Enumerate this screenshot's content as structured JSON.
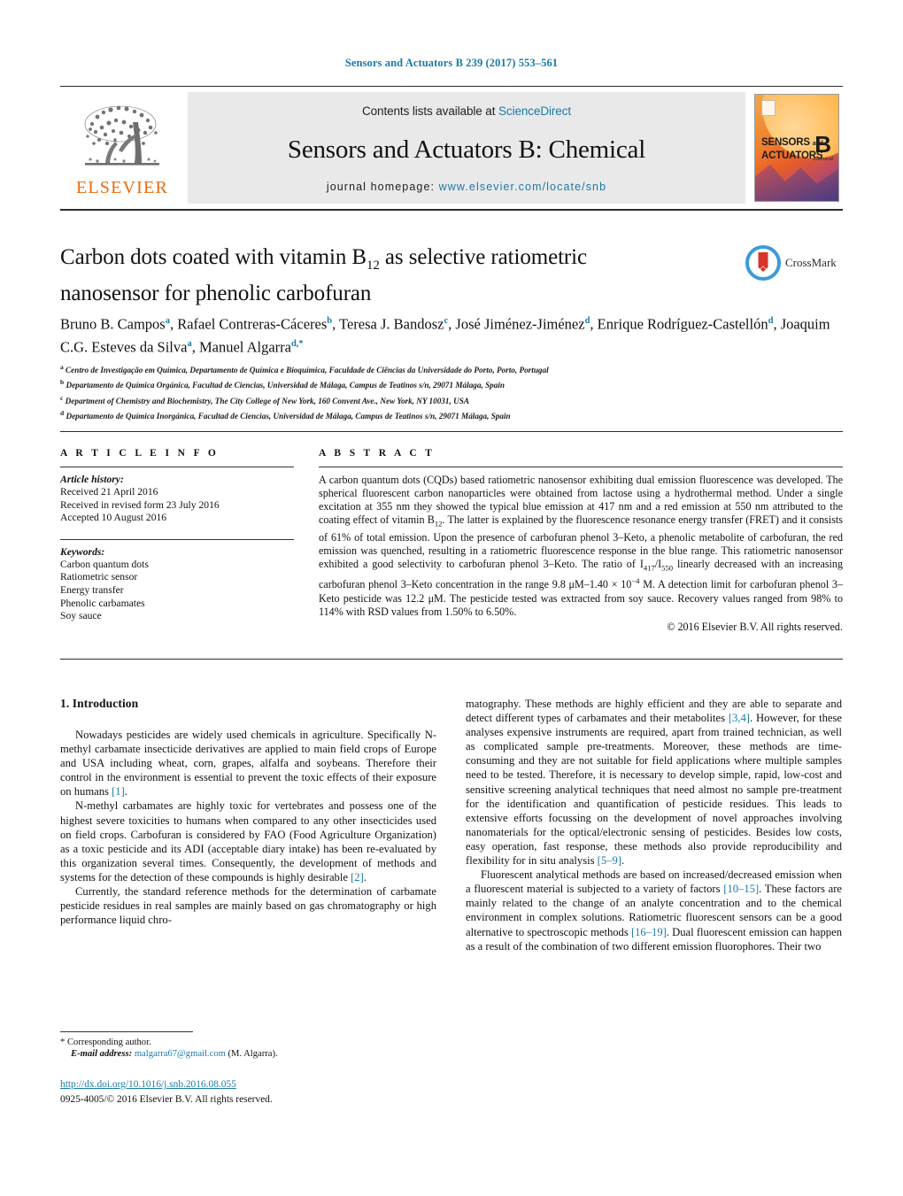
{
  "running_head": "Sensors and Actuators B 239 (2017) 553–561",
  "masthead": {
    "publisher_name": "ELSEVIER",
    "contents_prefix": "Contents lists available at ",
    "contents_link": "ScienceDirect",
    "journal_title": "Sensors and Actuators B: Chemical",
    "homepage_prefix": "journal homepage: ",
    "homepage_url": "www.elsevier.com/locate/snb",
    "cover_line1": "SENSORS",
    "cover_and": "and",
    "cover_line2": "ACTUATORS",
    "cover_volume": "B",
    "cover_sub": "Chemical"
  },
  "article": {
    "title_line1_a": "Carbon dots coated with vitamin B",
    "title_sub": "12",
    "title_line1_b": " as selective ratiometric",
    "title_line2": "nanosensor for phenolic carbofuran",
    "crossmark_label": "CrossMark",
    "authors_html": "Bruno B. Campos<sup>a</sup>, Rafael Contreras-Cáceres<sup>b</sup>, Teresa J. Bandosz<sup>c</sup>, José Jiménez-Jiménez<sup>d</sup>, Enrique Rodríguez-Castellón<sup>d</sup>, Joaquim C.G. Esteves da Silva<sup>a</sup>, Manuel Algarra<sup>d,*</sup>",
    "affiliations": [
      "Centro de Investigação em Química, Departamento de Química e Bioquímica, Faculdade de Ciências da Universidade do Porto, Porto, Portugal",
      "Departamento de Química Orgánica, Facultad de Ciencias, Universidad de Málaga, Campus de Teatinos s/n, 29071 Málaga, Spain",
      "Department of Chemistry and Biochemistry, The City College of New York, 160 Convent Ave., New York, NY 10031, USA",
      "Departamento de Química Inorgánica, Facultad de Ciencias, Universidad de Málaga, Campus de Teatinos s/n, 29071 Málaga, Spain"
    ],
    "affiliation_marks": [
      "a",
      "b",
      "c",
      "d"
    ]
  },
  "article_info": {
    "heading": "A R T I C L E   I N F O",
    "history_label": "Article history:",
    "history": [
      "Received 21 April 2016",
      "Received in revised form 23 July 2016",
      "Accepted 10 August 2016"
    ],
    "keywords_label": "Keywords:",
    "keywords": [
      "Carbon quantum dots",
      "Ratiometric sensor",
      "Energy transfer",
      "Phenolic carbamates",
      "Soy sauce"
    ]
  },
  "abstract": {
    "heading": "A B S T R A C T",
    "text_html": "A carbon quantum dots (CQDs) based ratiometric nanosensor exhibiting dual emission fluorescence was developed. The spherical fluorescent carbon nanoparticles were obtained from lactose using a hydrothermal method. Under a single excitation at 355 nm they showed the typical blue emission at 417 nm and a red emission at 550 nm attributed to the coating effect of vitamin B<sub>12</sub>. The latter is explained by the fluorescence resonance energy transfer (FRET) and it consists of 61% of total emission. Upon the presence of carbofuran phenol 3–Keto, a phenolic metabolite of carbofuran, the red emission was quenched, resulting in a ratiometric fluorescence response in the blue range. This ratiometric nanosensor exhibited a good selectivity to carbofuran phenol 3–Keto. The ratio of I<sub>417</sub>/I<sub>550</sub> linearly decreased with an increasing carbofuran phenol 3–Keto concentration in the range 9.8 &mu;M–1.40 &times; 10<sup>−4</sup> M. A detection limit for carbofuran phenol 3–Keto pesticide was 12.2 &mu;M. The pesticide tested was extracted from soy sauce. Recovery values ranged from 98% to 114% with RSD values from 1.50% to 6.50%.",
    "copyright": "© 2016 Elsevier B.V. All rights reserved."
  },
  "body": {
    "section_title": "1.  Introduction",
    "left_paragraphs_html": [
      "Nowadays pesticides are widely used chemicals in agriculture. Specifically N-methyl carbamate insecticide derivatives are applied to main field crops of Europe and USA including wheat, corn, grapes, alfalfa and soybeans. Therefore their control in the environment is essential to prevent the toxic effects of their exposure on humans <span class=\"ref\">[1]</span>.",
      "N-methyl carbamates are highly toxic for vertebrates and possess one of the highest severe toxicities to humans when compared to any other insecticides used on field crops. Carbofuran is considered by FAO (Food Agriculture Organization) as a toxic pesticide and its ADI (acceptable diary intake) has been re-evaluated by this organization several times. Consequently, the development of methods and systems for the detection of these compounds is highly desirable <span class=\"ref\">[2]</span>.",
      "Currently, the standard reference methods for the determination of carbamate pesticide residues in real samples are mainly based on gas chromatography or high performance liquid chro-"
    ],
    "right_paragraphs_html": [
      "matography. These methods are highly efficient and they are able to separate and detect different types of carbamates and their metabolites <span class=\"ref\">[3,4]</span>. However, for these analyses expensive instruments are required, apart from trained technician, as well as complicated sample pre-treatments. Moreover, these methods are time-consuming and they are not suitable for field applications where multiple samples need to be tested. Therefore, it is necessary to develop simple, rapid, low-cost and sensitive screening analytical techniques that need almost no sample pre-treatment for the identification and quantification of pesticide residues. This leads to extensive efforts focussing on the development of novel approaches involving nanomaterials for the optical/electronic sensing of pesticides. Besides low costs, easy operation, fast response, these methods also provide reproducibility and flexibility for in situ analysis <span class=\"ref\">[5–9]</span>.",
      "Fluorescent analytical methods are based on increased/decreased emission when a fluorescent material is subjected to a variety of factors <span class=\"ref\">[10–15]</span>. These factors are mainly related to the change of an analyte concentration and to the chemical environment in complex solutions. Ratiometric fluorescent sensors can be a good alternative to spectroscopic methods <span class=\"ref\">[16–19]</span>. Dual fluorescent emission can happen as a result of the combination of two different emission fluorophores. Their two"
    ]
  },
  "footer": {
    "corresponding_mark": "*",
    "corresponding_label": "Corresponding author.",
    "email_label": "E-mail address:",
    "email": "malgarra67@gmail.com",
    "email_suffix": "(M. Algarra).",
    "doi_url": "http://dx.doi.org/10.1016/j.snb.2016.08.055",
    "issn_line": "0925-4005/© 2016 Elsevier B.V. All rights reserved."
  },
  "colors": {
    "link": "#1a7aa8",
    "elsevier_orange": "#eb6b09"
  }
}
